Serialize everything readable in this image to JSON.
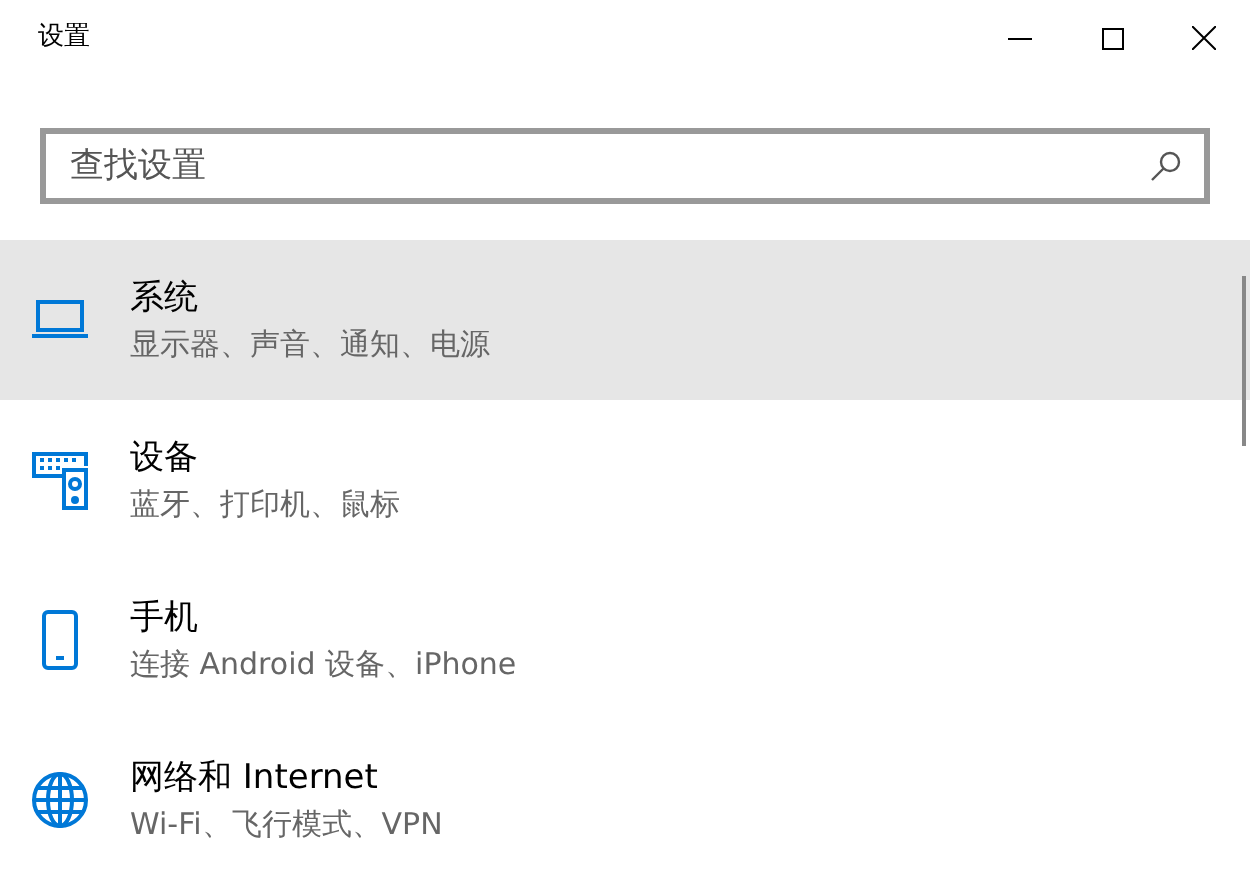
{
  "window": {
    "title": "设置"
  },
  "search": {
    "placeholder": "查找设置"
  },
  "items": [
    {
      "title": "系统",
      "subtitle": "显示器、声音、通知、电源",
      "selected": true
    },
    {
      "title": "设备",
      "subtitle": "蓝牙、打印机、鼠标",
      "selected": false
    },
    {
      "title": "手机",
      "subtitle": "连接 Android 设备、iPhone",
      "selected": false
    },
    {
      "title": "网络和 Internet",
      "subtitle": "Wi-Fi、飞行模式、VPN",
      "selected": false
    }
  ]
}
